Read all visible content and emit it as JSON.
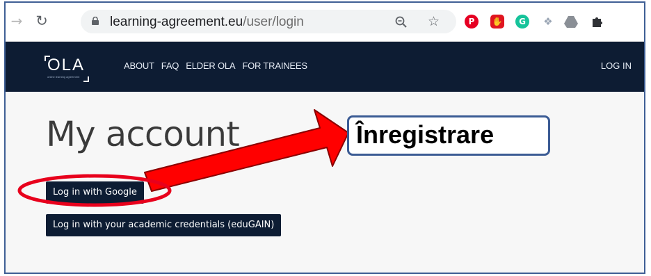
{
  "browser": {
    "url_domain": "learning-agreement.eu",
    "url_path": "/user/login",
    "icons": [
      "back-arrow-icon",
      "reload-icon",
      "lock-icon",
      "zoom-icon",
      "star-icon",
      "pinterest-icon",
      "adblock-icon",
      "grammarly-icon",
      "dropbox-icon",
      "drive-icon",
      "extensions-puzzle-icon"
    ]
  },
  "header": {
    "logo_text": "OLA",
    "logo_sub": "online learning agreement",
    "nav": [
      "ABOUT",
      "FAQ",
      "ELDER OLA",
      "FOR TRAINEES"
    ],
    "login": "LOG IN"
  },
  "main": {
    "title": "My account",
    "google_button": "Log in with Google",
    "edugain_button": "Log in with your academic credentials (eduGAIN)"
  },
  "annotation": {
    "label": "Înregistrare",
    "colors": {
      "arrow": "#ff0000",
      "box_border": "#3b5b94",
      "ellipse": "#e8001c"
    }
  },
  "colors": {
    "header_bg": "#0d1c33",
    "button_bg": "#0d1c33"
  }
}
